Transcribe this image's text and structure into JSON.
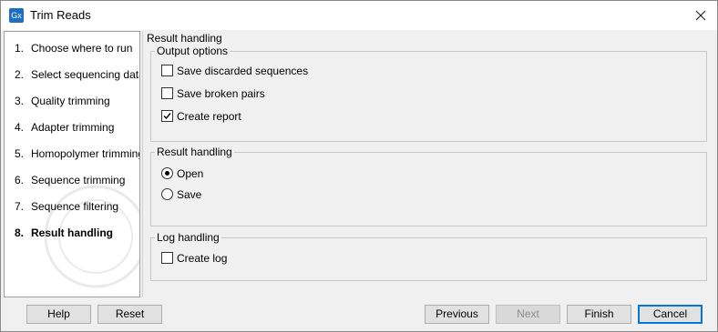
{
  "window": {
    "title": "Trim Reads",
    "app_icon_text": "Gx"
  },
  "steps": [
    {
      "num": "1.",
      "label": "Choose where to run"
    },
    {
      "num": "2.",
      "label": "Select sequencing data"
    },
    {
      "num": "3.",
      "label": "Quality trimming"
    },
    {
      "num": "4.",
      "label": "Adapter trimming"
    },
    {
      "num": "5.",
      "label": "Homopolymer trimming"
    },
    {
      "num": "6.",
      "label": "Sequence trimming"
    },
    {
      "num": "7.",
      "label": "Sequence filtering"
    },
    {
      "num": "8.",
      "label": "Result handling",
      "active": true
    }
  ],
  "panel": {
    "title": "Result handling",
    "output_options": {
      "title": "Output options",
      "save_discarded": {
        "label": "Save discarded sequences",
        "checked": false
      },
      "save_broken_pairs": {
        "label": "Save broken pairs",
        "checked": false
      },
      "create_report": {
        "label": "Create report",
        "checked": true
      }
    },
    "result_handling": {
      "title": "Result handling",
      "open": {
        "label": "Open",
        "selected": true
      },
      "save": {
        "label": "Save",
        "selected": false
      }
    },
    "log_handling": {
      "title": "Log handling",
      "create_log": {
        "label": "Create log",
        "checked": false
      }
    }
  },
  "buttons": {
    "help": "Help",
    "reset": "Reset",
    "previous": "Previous",
    "next": "Next",
    "finish": "Finish",
    "cancel": "Cancel"
  }
}
